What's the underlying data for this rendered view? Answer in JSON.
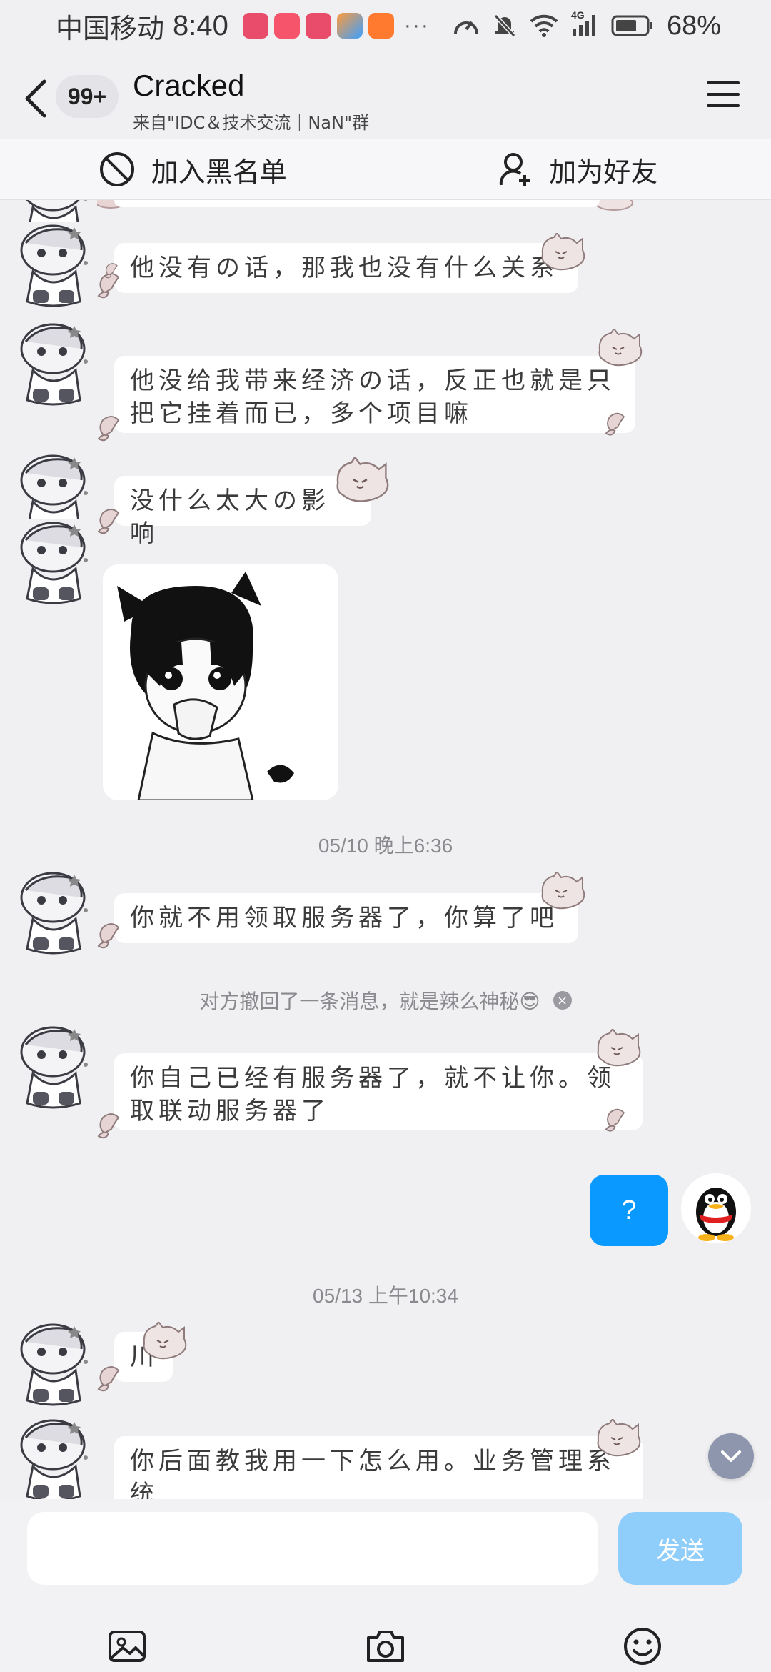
{
  "status_bar": {
    "carrier": "中国移动",
    "time": "8:40",
    "more": "···",
    "network": "4G",
    "battery": "68%"
  },
  "header": {
    "unread_badge": "99+",
    "title": "Cracked",
    "subtitle": "来自\"IDC＆技术交流｜NaN\"群"
  },
  "actions": {
    "blacklist": "加入黑名单",
    "add_friend": "加为好友"
  },
  "messages": [
    {
      "text": "他没有の话，那我也没有什么关系"
    },
    {
      "line1": "他没给我带来经济の话，反正也就是只",
      "line2": "把它挂着而已，多个项目嘛"
    },
    {
      "text": "没什么太大の影响"
    },
    {
      "text": "你就不用领取服务器了，你算了吧"
    },
    {
      "line1": "你自己已经有服务器了，就不让你。领",
      "line2": "取联动服务器了"
    },
    {
      "text": "川"
    },
    {
      "line1": "你后面教我用一下怎么用。业务管理系",
      "line2": "统"
    }
  ],
  "timestamps": [
    "05/10 晚上6:36",
    "05/13 上午10:34"
  ],
  "recall_notice": "对方撤回了一条消息，就是辣么神秘😎",
  "my_message": "?",
  "input": {
    "placeholder": "",
    "send_label": "发送"
  },
  "colors": {
    "accent": "#0a99ff",
    "send_disabled": "#8fcdfb",
    "background": "#f0f0f3"
  }
}
